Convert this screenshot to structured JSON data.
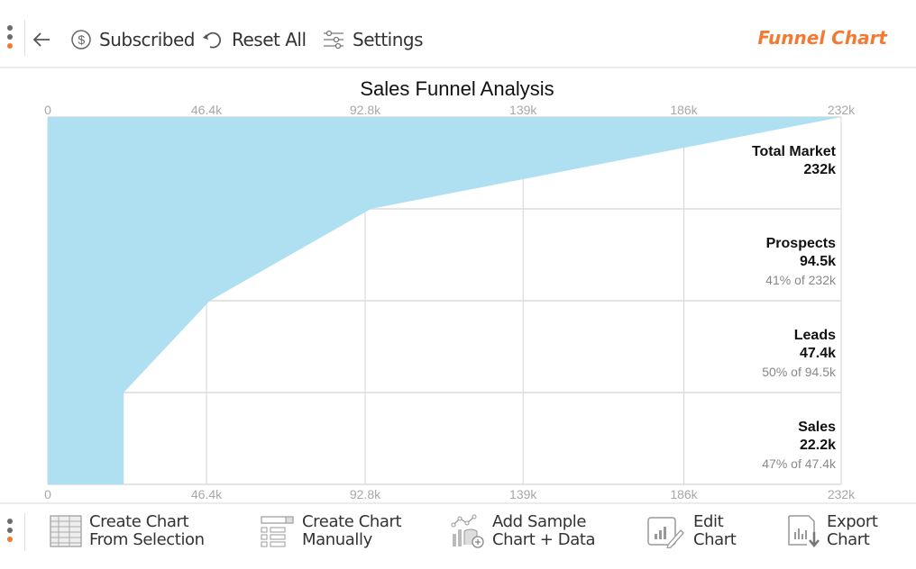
{
  "toolbar": {
    "back_label": "",
    "subscribed_label": "Subscribed",
    "reset_label": "Reset All",
    "settings_label": "Settings",
    "brand_title": "Funnel Chart",
    "accent_color": "#f37a33"
  },
  "bottom_toolbar": {
    "items": [
      {
        "line1": "Create Chart",
        "line2": "From Selection",
        "icon": "table-grid-icon"
      },
      {
        "line1": "Create Chart",
        "line2": "Manually",
        "icon": "form-list-icon"
      },
      {
        "line1": "Add Sample",
        "line2": "Chart + Data",
        "icon": "sample-data-icon"
      },
      {
        "line1": "Edit",
        "line2": "Chart",
        "icon": "edit-chart-icon"
      },
      {
        "line1": "Export",
        "line2": "Chart",
        "icon": "export-chart-icon"
      }
    ]
  },
  "chart_data": {
    "type": "funnel",
    "title": "Sales Funnel Analysis",
    "fill_color": "#aee0f2",
    "xlim": [
      0,
      232000
    ],
    "x_ticks": [
      0,
      46400,
      92800,
      139000,
      186000,
      232000
    ],
    "x_tick_labels": [
      "0",
      "46.4k",
      "92.8k",
      "139k",
      "186k",
      "232k"
    ],
    "grid": true,
    "stages": [
      {
        "name": "Total Market",
        "value": 232000,
        "value_label": "232k",
        "pct_label": ""
      },
      {
        "name": "Prospects",
        "value": 94500,
        "value_label": "94.5k",
        "pct_label": "41% of 232k"
      },
      {
        "name": "Leads",
        "value": 47400,
        "value_label": "47.4k",
        "pct_label": "50% of 94.5k"
      },
      {
        "name": "Sales",
        "value": 22200,
        "value_label": "22.2k",
        "pct_label": "47% of 47.4k"
      }
    ]
  }
}
